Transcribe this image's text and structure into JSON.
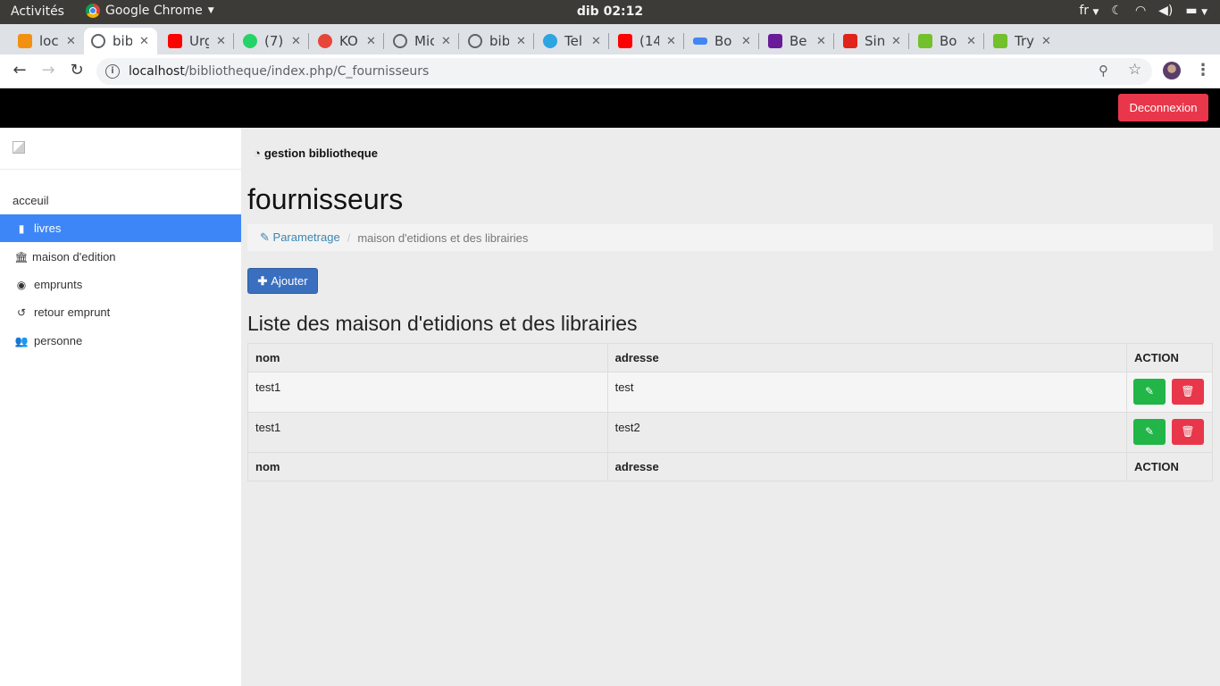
{
  "os": {
    "activities": "Activités",
    "app_name": "Google Chrome",
    "clock": "dib 02:12",
    "lang": "fr"
  },
  "browser": {
    "tabs": [
      {
        "title": "loc",
        "favicon": "pma-icon",
        "color": "#f29111"
      },
      {
        "title": "bib",
        "favicon": "globe-icon",
        "color": "#5f6368"
      },
      {
        "title": "Urg",
        "favicon": "youtube-icon",
        "color": "#ff0000"
      },
      {
        "title": "(7)",
        "favicon": "whatsapp-icon",
        "color": "#25d366"
      },
      {
        "title": "KO",
        "favicon": "e-icon",
        "color": "#e8463a"
      },
      {
        "title": "Mic",
        "favicon": "globe-icon",
        "color": "#5f6368"
      },
      {
        "title": "bib",
        "favicon": "globe-icon",
        "color": "#5f6368"
      },
      {
        "title": "Tel",
        "favicon": "telegram-icon",
        "color": "#2ca5e0"
      },
      {
        "title": "(14",
        "favicon": "youtube-icon",
        "color": "#ff0000"
      },
      {
        "title": "Bo",
        "favicon": "mdb-icon",
        "color": "#4285f4"
      },
      {
        "title": "Be",
        "favicon": "colorlib-icon",
        "color": "#6a1b9a"
      },
      {
        "title": "Sin",
        "favicon": "s-icon",
        "color": "#e0241b"
      },
      {
        "title": "Bo",
        "favicon": "w3-icon",
        "color": "#72c02c"
      },
      {
        "title": "Try",
        "favicon": "w3-icon",
        "color": "#72c02c"
      }
    ],
    "url_host": "localhost",
    "url_path": "/bibliotheque/index.php/C_fournisseurs"
  },
  "navbar": {
    "logout_label": "Deconnexion"
  },
  "sidebar": {
    "items": [
      {
        "label": "acceuil",
        "icon": ""
      },
      {
        "label": "livres",
        "icon": "book-icon"
      },
      {
        "label": "maison d'edition",
        "icon": "bank-icon"
      },
      {
        "label": "emprunts",
        "icon": "circle-dot-icon"
      },
      {
        "label": "retour emprunt",
        "icon": "history-icon"
      },
      {
        "label": "personne",
        "icon": "users-icon"
      }
    ]
  },
  "main": {
    "header": "gestion bibliotheque",
    "page_title": "fournisseurs",
    "breadcrumb": {
      "parent": "Parametrage",
      "current": "maison d'etidions et des librairies"
    },
    "add_label": "Ajouter",
    "list_title": "Liste des maison d'etidions et des librairies",
    "table": {
      "headers": [
        "nom",
        "adresse",
        "ACTION"
      ],
      "rows": [
        {
          "nom": "test1",
          "adresse": "test"
        },
        {
          "nom": "test1",
          "adresse": "test2"
        }
      ],
      "footers": [
        "nom",
        "adresse",
        "ACTION"
      ]
    }
  }
}
